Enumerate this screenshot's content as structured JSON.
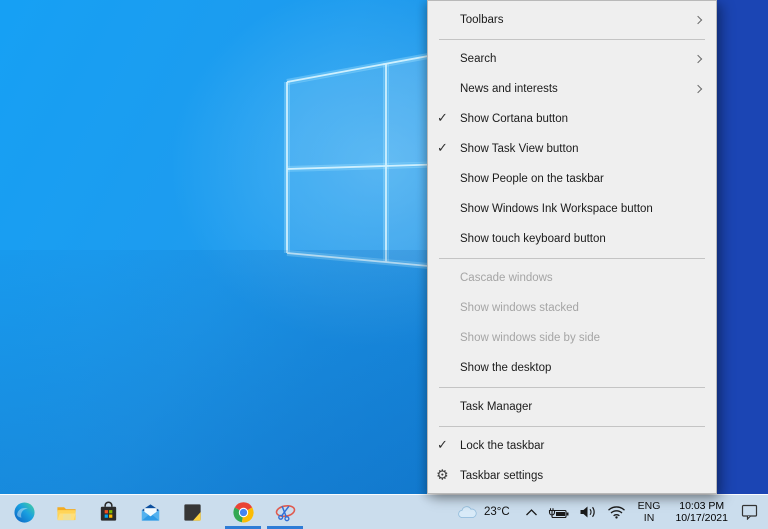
{
  "desktop": {
    "wallpaper_colors": {
      "sky_blue": "#16a0f4",
      "window_glow": "#cfeeff",
      "deep_blue_right": "#1b45b4"
    }
  },
  "context_menu": {
    "bg_color": "#efefef",
    "items": [
      {
        "label": "Toolbars",
        "submenu": true
      },
      {
        "separator": true
      },
      {
        "label": "Search",
        "submenu": true
      },
      {
        "label": "News and interests",
        "submenu": true
      },
      {
        "label": "Show Cortana button",
        "checked": true
      },
      {
        "label": "Show Task View button",
        "checked": true
      },
      {
        "label": "Show People on the taskbar"
      },
      {
        "label": "Show Windows Ink Workspace button"
      },
      {
        "label": "Show touch keyboard button"
      },
      {
        "separator": true
      },
      {
        "label": "Cascade windows",
        "disabled": true
      },
      {
        "label": "Show windows stacked",
        "disabled": true
      },
      {
        "label": "Show windows side by side",
        "disabled": true
      },
      {
        "label": "Show the desktop"
      },
      {
        "separator": true
      },
      {
        "label": "Task Manager"
      },
      {
        "separator": true
      },
      {
        "label": "Lock the taskbar",
        "checked": true
      },
      {
        "label": "Taskbar settings",
        "icon": "gear"
      }
    ],
    "glyphs": {
      "check": "✓",
      "gear": "⚙"
    }
  },
  "taskbar": {
    "bg_color": "#cbdded",
    "running_indicator_color": "#2e7cd6",
    "apps": [
      {
        "name": "microsoft-edge",
        "running": false
      },
      {
        "name": "file-explorer",
        "running": false
      },
      {
        "name": "microsoft-store",
        "running": false
      },
      {
        "name": "mail",
        "running": false
      },
      {
        "name": "sticky-notes",
        "running": false
      },
      {
        "name": "chrome",
        "running": true
      },
      {
        "name": "snipping-tool",
        "running": true
      }
    ],
    "tray": {
      "weather_temp": "23°C",
      "language_line1": "ENG",
      "language_line2": "IN",
      "time": "10:03 PM",
      "date": "10/17/2021"
    }
  }
}
